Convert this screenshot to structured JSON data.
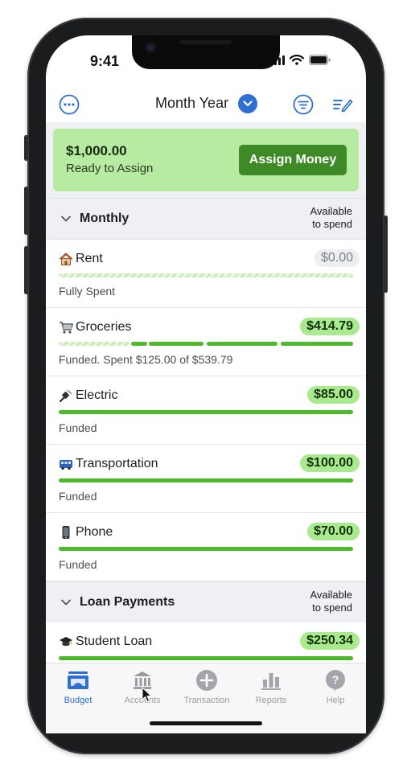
{
  "status": {
    "time": "9:41"
  },
  "nav": {
    "title": "Month Year"
  },
  "ready": {
    "amount": "$1,000.00",
    "label": "Ready to Assign",
    "button": "Assign Money"
  },
  "groups": [
    {
      "name": "Monthly",
      "available_label": [
        "Available",
        "to spend"
      ],
      "categories": [
        {
          "emoji": "house-icon",
          "name": "Rent",
          "amount": "$0.00",
          "status": "Fully Spent"
        },
        {
          "emoji": "shopping-cart-icon",
          "name": "Groceries",
          "amount": "$414.79",
          "status": "Funded. Spent $125.00 of $539.79"
        },
        {
          "emoji": "electric-plug-icon",
          "name": "Electric",
          "amount": "$85.00",
          "status": "Funded"
        },
        {
          "emoji": "bus-icon",
          "name": "Transportation",
          "amount": "$100.00",
          "status": "Funded"
        },
        {
          "emoji": "mobile-phone-icon",
          "name": "Phone",
          "amount": "$70.00",
          "status": "Funded"
        }
      ]
    },
    {
      "name": "Loan Payments",
      "available_label": [
        "Available",
        "to spend"
      ],
      "categories": [
        {
          "emoji": "graduation-cap-icon",
          "name": "Student Loan",
          "amount": "$250.34"
        }
      ]
    }
  ],
  "tabs": [
    {
      "label": "Budget",
      "icon": "budget-icon",
      "active": true
    },
    {
      "label": "Accounts",
      "icon": "bank-icon",
      "active": false
    },
    {
      "label": "Transaction",
      "icon": "plus-circle-icon",
      "active": false
    },
    {
      "label": "Reports",
      "icon": "bar-chart-icon",
      "active": false
    },
    {
      "label": "Help",
      "icon": "help-bubble-icon",
      "active": false
    }
  ],
  "colors": {
    "accent": "#2f6fd1",
    "funded": "#4dba2a",
    "pill": "#a9ea8e",
    "ready_bg": "#b8eba2",
    "assign_btn": "#3d8a26"
  }
}
